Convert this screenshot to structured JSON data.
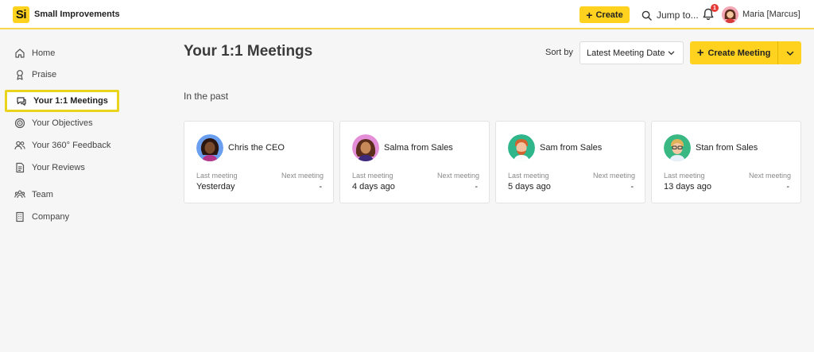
{
  "app": {
    "logo_text": "Si",
    "name": "Small Improvements"
  },
  "topbar": {
    "create_label": "Create",
    "jump_label": "Jump to...",
    "notification_count": "1",
    "user_label": "Maria [Marcus]"
  },
  "sidebar": {
    "items": [
      {
        "label": "Home",
        "icon": "home-icon"
      },
      {
        "label": "Praise",
        "icon": "award-icon"
      },
      {
        "label": "Your 1:1 Meetings",
        "icon": "chat-icon",
        "active": true
      },
      {
        "label": "Your Objectives",
        "icon": "target-icon"
      },
      {
        "label": "Your 360° Feedback",
        "icon": "people-icon"
      },
      {
        "label": "Your Reviews",
        "icon": "document-icon"
      },
      {
        "label": "Team",
        "icon": "team-icon"
      },
      {
        "label": "Company",
        "icon": "building-icon"
      }
    ]
  },
  "main": {
    "title": "Your 1:1 Meetings",
    "sort_label": "Sort by",
    "sort_value": "Latest Meeting Date",
    "create_meeting_label": "Create Meeting",
    "section_title": "In the past",
    "last_meeting_label": "Last meeting",
    "next_meeting_label": "Next meeting",
    "cards": [
      {
        "name": "Chris the CEO",
        "last": "Yesterday",
        "next": "-"
      },
      {
        "name": "Salma from Sales",
        "last": "4 days ago",
        "next": "-"
      },
      {
        "name": "Sam from Sales",
        "last": "5 days ago",
        "next": "-"
      },
      {
        "name": "Stan from Sales",
        "last": "13 days ago",
        "next": "-"
      }
    ]
  },
  "colors": {
    "accent": "#ffd21f",
    "active_border": "#ead31c",
    "badge": "#e53935"
  }
}
